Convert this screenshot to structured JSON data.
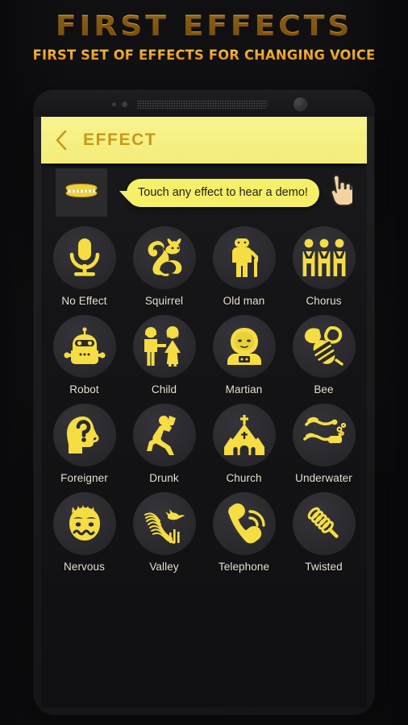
{
  "header": {
    "title": "FIRST EFFECTS",
    "subtitle": "FIRST SET OF EFFECTS FOR CHANGING VOICE"
  },
  "colors": {
    "title_gold": "#f0a62b",
    "appbar_yellow": "#f3ec7a",
    "appbar_title_gold": "#c79a19",
    "bubble_yellow": "#f6ef6a",
    "icon_yellow": "#f5dd43",
    "disc_dark": "#2a2a2f",
    "label_cream": "#e9e2cf",
    "screen_bg": "#141416",
    "phone_body": "#1b1b1d",
    "hand_skin": "#f5d3a0"
  },
  "phone": {
    "status": {
      "sensor_icon": "proximity-sensor-dot",
      "grille_icon": "earpiece-speaker-grille",
      "camera_icon": "front-camera-lens"
    }
  },
  "appbar": {
    "back_icon": "chevron-left-icon",
    "title": "EFFECT"
  },
  "hint": {
    "thumb_icon": "mouth-teeth-icon",
    "bubble_text": "Touch any effect to hear a demo!",
    "hand_icon": "pointing-hand-icon"
  },
  "effects": [
    {
      "label": "No Effect",
      "icon": "microphone-icon"
    },
    {
      "label": "Squirrel",
      "icon": "squirrel-icon"
    },
    {
      "label": "Old man",
      "icon": "old-man-cane-icon"
    },
    {
      "label": "Chorus",
      "icon": "three-people-icon"
    },
    {
      "label": "Robot",
      "icon": "robot-icon"
    },
    {
      "label": "Child",
      "icon": "boy-and-girl-icon"
    },
    {
      "label": "Martian",
      "icon": "astronaut-icon"
    },
    {
      "label": "Bee",
      "icon": "bee-icon"
    },
    {
      "label": "Foreigner",
      "icon": "head-question-mark-icon"
    },
    {
      "label": "Drunk",
      "icon": "drinking-runner-icon"
    },
    {
      "label": "Church",
      "icon": "church-icon"
    },
    {
      "label": "Underwater",
      "icon": "scuba-diver-icon"
    },
    {
      "label": "Nervous",
      "icon": "nervous-face-icon"
    },
    {
      "label": "Valley",
      "icon": "valley-bird-icon"
    },
    {
      "label": "Telephone",
      "icon": "telephone-handset-icon"
    },
    {
      "label": "Twisted",
      "icon": "corkscrew-spiral-icon"
    }
  ]
}
